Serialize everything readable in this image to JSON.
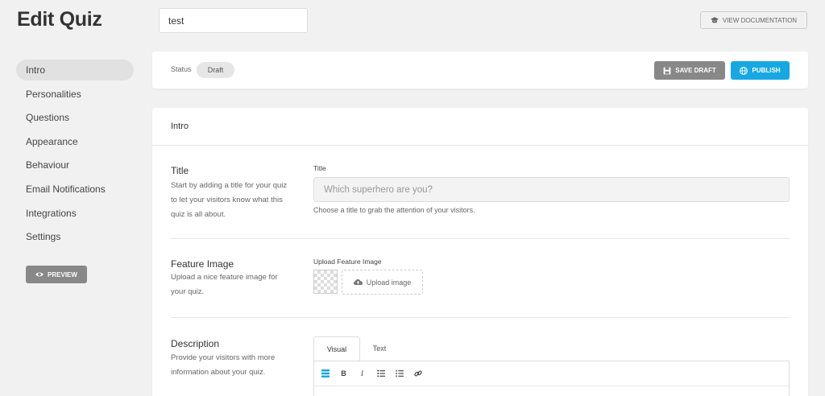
{
  "header": {
    "title": "Edit Quiz",
    "quiz_name": "test",
    "doc_button": "VIEW DOCUMENTATION"
  },
  "sidebar": {
    "items": [
      {
        "label": "Intro",
        "active": true
      },
      {
        "label": "Personalities",
        "active": false
      },
      {
        "label": "Questions",
        "active": false
      },
      {
        "label": "Appearance",
        "active": false
      },
      {
        "label": "Behaviour",
        "active": false
      },
      {
        "label": "Email Notifications",
        "active": false
      },
      {
        "label": "Integrations",
        "active": false
      },
      {
        "label": "Settings",
        "active": false
      }
    ],
    "preview_button": "PREVIEW"
  },
  "status_bar": {
    "label": "Status",
    "value": "Draft",
    "save_button": "SAVE DRAFT",
    "publish_button": "PUBLISH"
  },
  "main": {
    "header": "Intro",
    "title_section": {
      "heading": "Title",
      "description": "Start by adding a title for your quiz to let your visitors know what this quiz is all about.",
      "field_label": "Title",
      "placeholder": "Which superhero are you?",
      "help": "Choose a title to grab the attention of your visitors."
    },
    "image_section": {
      "heading": "Feature Image",
      "description": "Upload a nice feature image for your quiz.",
      "field_label": "Upload Feature Image",
      "upload_button": "Upload image"
    },
    "description_section": {
      "heading": "Description",
      "description": "Provide your visitors with more information about your quiz.",
      "tabs": [
        "Visual",
        "Text"
      ]
    }
  },
  "colors": {
    "accent": "#17a8e3",
    "secondary_button": "#888888",
    "background": "#f1f1f1"
  }
}
